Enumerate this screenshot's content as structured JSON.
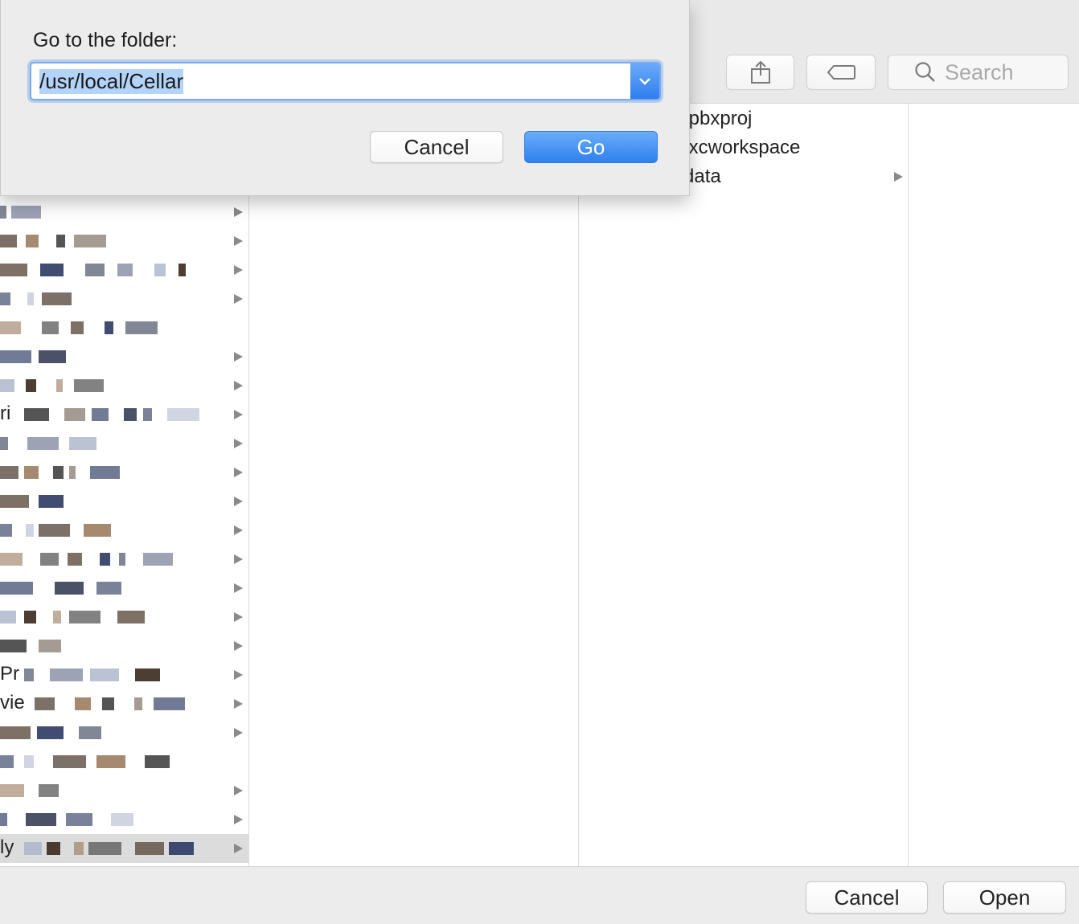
{
  "toolbar": {
    "search_placeholder": "Search",
    "share_icon": "share-icon",
    "tag_icon": "tag-icon",
    "search_icon": "search-icon"
  },
  "sidebar_rows": [
    {
      "text": "",
      "chevron": true
    },
    {
      "text": "",
      "chevron": true
    },
    {
      "text": "",
      "chevron": true
    },
    {
      "text": "",
      "chevron": true
    },
    {
      "text": "",
      "chevron": false
    },
    {
      "text": "",
      "chevron": true
    },
    {
      "text": "",
      "chevron": true
    },
    {
      "text": "ri",
      "chevron": true
    },
    {
      "text": "",
      "chevron": true
    },
    {
      "text": "",
      "chevron": true
    },
    {
      "text": "",
      "chevron": true
    },
    {
      "text": "",
      "chevron": true
    },
    {
      "text": "",
      "chevron": true
    },
    {
      "text": "",
      "chevron": true
    },
    {
      "text": "",
      "chevron": true
    },
    {
      "text": "",
      "chevron": true
    },
    {
      "text": "Pr",
      "chevron": true
    },
    {
      "text": "vie",
      "chevron": true
    },
    {
      "text": "",
      "chevron": true
    },
    {
      "text": "",
      "chevron": false
    },
    {
      "text": "",
      "chevron": true
    },
    {
      "text": "",
      "chevron": true
    },
    {
      "text": "ly",
      "chevron": true,
      "selected": true
    }
  ],
  "column3_items": [
    {
      "label": ".pbxproj",
      "chevron": false
    },
    {
      "label": ".xcworkspace",
      "chevron": false
    },
    {
      "label": "data",
      "chevron": true
    }
  ],
  "sheet": {
    "label": "Go to the folder:",
    "path_value": "/usr/local/Cellar",
    "cancel_label": "Cancel",
    "go_label": "Go"
  },
  "footer": {
    "cancel_label": "Cancel",
    "open_label": "Open"
  },
  "colors": {
    "accent": "#2f80f0",
    "focus_ring": "#7aa9ee"
  }
}
